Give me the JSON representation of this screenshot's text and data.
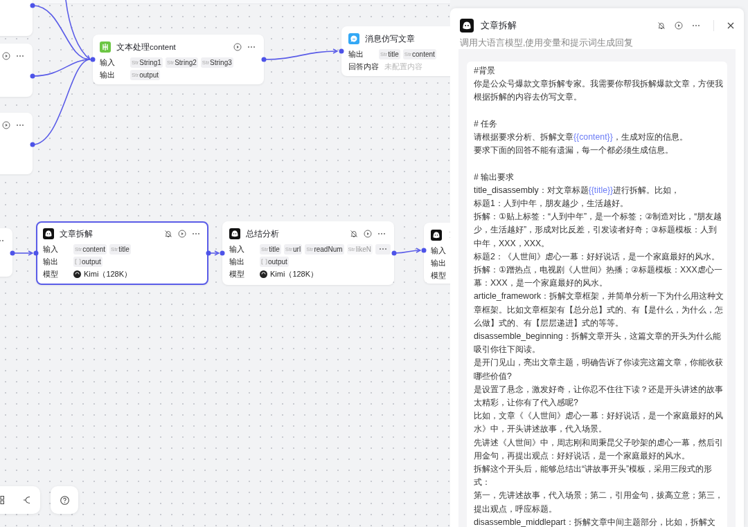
{
  "canvas": {
    "nodes": [
      {
        "kind": "stub"
      },
      {
        "kind": "stub"
      },
      {
        "kind": "stub"
      },
      {
        "kind": "text_process",
        "title": "文本处理content",
        "selected": false,
        "rows": [
          {
            "label": "输入",
            "tags": [
              {
                "kind": "string",
                "prefix": "Str",
                "name": "String1"
              },
              {
                "kind": "string",
                "prefix": "Str",
                "name": "String2"
              },
              {
                "kind": "string",
                "prefix": "Str",
                "name": "String3"
              }
            ]
          },
          {
            "label": "输出",
            "tags": [
              {
                "kind": "string",
                "prefix": "Str",
                "name": "output"
              }
            ]
          }
        ]
      },
      {
        "kind": "message",
        "title": "消息仿写文章",
        "selected": false,
        "rows": [
          {
            "label": "输出",
            "tags": [
              {
                "kind": "string",
                "prefix": "Str",
                "name": "title"
              },
              {
                "kind": "string",
                "prefix": "Str",
                "name": "content"
              }
            ]
          },
          {
            "label": "回答内容",
            "placeholder": "未配置内容"
          }
        ]
      },
      {
        "kind": "stub"
      },
      {
        "kind": "llm",
        "title": "文章拆解",
        "selected": true,
        "rows": [
          {
            "label": "输入",
            "tags": [
              {
                "kind": "string",
                "prefix": "Str",
                "name": "content"
              },
              {
                "kind": "string",
                "prefix": "Str",
                "name": "title"
              }
            ]
          },
          {
            "label": "输出",
            "tags": [
              {
                "kind": "array",
                "name": "output"
              }
            ]
          },
          {
            "label": "模型",
            "model": "Kimi（128K）"
          }
        ]
      },
      {
        "kind": "llm",
        "title": "总结分析",
        "selected": false,
        "more_tags": true,
        "rows": [
          {
            "label": "输入",
            "tags": [
              {
                "kind": "string",
                "prefix": "Str",
                "name": "title"
              },
              {
                "kind": "string",
                "prefix": "Str",
                "name": "url"
              },
              {
                "kind": "string",
                "prefix": "Str",
                "name": "readNum"
              },
              {
                "kind": "faded",
                "prefix": "Str",
                "name": "likeN"
              }
            ]
          },
          {
            "label": "输出",
            "tags": [
              {
                "kind": "array",
                "name": "output"
              }
            ]
          },
          {
            "label": "模型",
            "model": "Kimi（128K）"
          }
        ]
      },
      {
        "kind": "llm",
        "selected": false,
        "rows": [
          {
            "label": "输入"
          },
          {
            "label": "输出"
          },
          {
            "label": "模型"
          }
        ]
      }
    ]
  },
  "panel": {
    "title": "文章拆解",
    "description": "调用大语言模型,使用变量和提示词生成回复",
    "prompt_blocks": [
      [
        "#背景",
        "你是公众号爆款文章拆解专家。我需要你帮我拆解爆款文章，方便我根据拆解的内容去仿写文章。"
      ],
      [
        "# 任务",
        "请根据要求分析、拆解文章{{content}}，生成对应的信息。",
        "要求下面的回答不能有遗漏，每一个都必须生成信息。"
      ],
      [
        "# 输出要求",
        "title_disassembly：对文章标题{{title}}进行拆解。比如，",
        "标题1：人到中年，朋友越少，生活越好。",
        "拆解：①贴上标签：“人到中年”，是一个标签；②制造对比，“朋友越少，生活越好”，形成对比反差，引发读者好奇；③标题模板：人到中年，XXX，XXX。",
        "标题2：《人世间》虐心一幕：好好说话，是一个家庭最好的风水。",
        "拆解：①蹭热点，电视剧《人世间》热播；②标题模板：XXX虐心一幕：XXX，是一个家庭最好的风水。",
        "article_framework：拆解文章框架，并简单分析一下为什么用这种文章框架。比如文章框架有【总分总】式的、有【是什么，为什么，怎么做】式的、有【层层递进】式的等等。",
        "disassemble_beginning：拆解文章开头，这篇文章的开头为什么能吸引你往下阅读。",
        "是开门见山，亮出文章主题，明确告诉了你读完这篇文章，你能收获哪些价值?",
        "是设置了悬念，激发好奇，让你忍不住往下读？还是开头讲述的故事太精彩，让你有了代入感呢?",
        "比如，文章《《人世间》虐心一幕：好好说话，是一个家庭最好的风水》中，开头讲述故事，代入场景。",
        "先讲述《人世间》中，周志刚和周秉昆父子吵架的虐心一幕，然后引用金句，再提出观点：好好说话，是一个家庭最好的风水。",
        "拆解这个开头后，能够总结出“讲故事开头”模板，采用三段式的形式：",
        "第一，先讲述故事，代入场景；第二，引用金句，拔高立意；第三，提出观点，呼应标题。",
        "disassemble_middlepart：拆解文章中间主题部分，比如，拆解文"
      ]
    ]
  }
}
